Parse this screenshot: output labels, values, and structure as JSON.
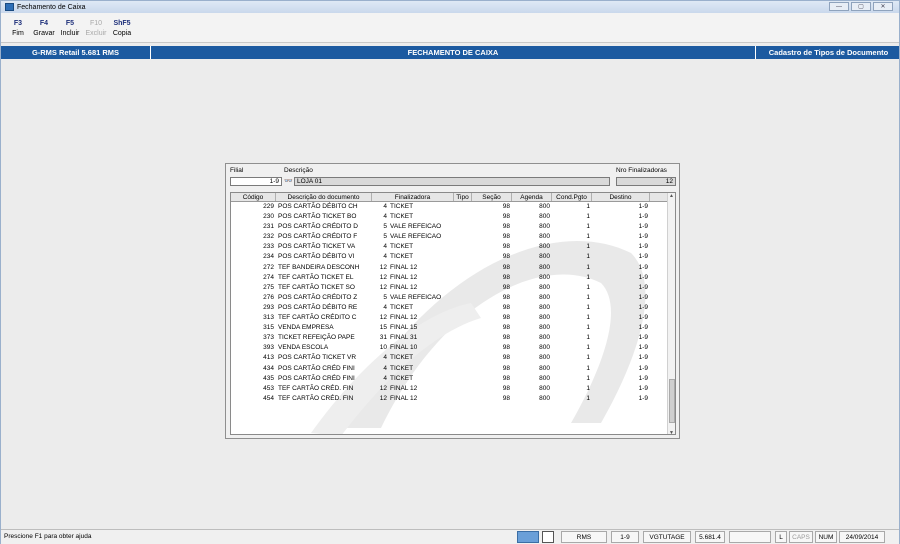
{
  "window": {
    "title": "Fechamento de Caixa",
    "controls": [
      "—",
      "▢",
      "✕"
    ]
  },
  "toolbar": {
    "buttons": [
      {
        "key": "F3",
        "label": "Fim",
        "enabled": true
      },
      {
        "key": "F4",
        "label": "Gravar",
        "enabled": true
      },
      {
        "key": "F5",
        "label": "Incluir",
        "enabled": true
      },
      {
        "key": "F10",
        "label": "Excluir",
        "enabled": false
      },
      {
        "key": "ShF5",
        "label": "Copia",
        "enabled": true
      }
    ]
  },
  "header": {
    "left": "G-RMS Retail 5.681 RMS",
    "center": "FECHAMENTO DE CAIXA",
    "right": "Cadastro de Tipos de Documento"
  },
  "form": {
    "filial_label": "Filial",
    "filial_value": "1-9",
    "descricao_label": "Descrição",
    "descricao_value": "LOJA 01",
    "nro_label": "Nro Finalizadoras",
    "nro_value": "12"
  },
  "table": {
    "columns": [
      "Código",
      "Descrição do documento",
      "Finalizadora",
      "Tipo",
      "Seção",
      "Agenda",
      "Cond.Pgto",
      "Destino"
    ],
    "rows": [
      {
        "codigo": "229",
        "descricao": "POS CARTÃO DÉBITO CH",
        "fin_num": "4",
        "fin_nome": "TICKET",
        "tipo": "",
        "secao": "98",
        "agenda": "800",
        "cond": "1",
        "destino": "1-9"
      },
      {
        "codigo": "230",
        "descricao": "POS CARTÃO TICKET BO",
        "fin_num": "4",
        "fin_nome": "TICKET",
        "tipo": "",
        "secao": "98",
        "agenda": "800",
        "cond": "1",
        "destino": "1-9"
      },
      {
        "codigo": "231",
        "descricao": "POS CARTÃO CRÉDITO D",
        "fin_num": "5",
        "fin_nome": "VALE REFEICAO",
        "tipo": "",
        "secao": "98",
        "agenda": "800",
        "cond": "1",
        "destino": "1-9"
      },
      {
        "codigo": "232",
        "descricao": "POS CARTÃO CRÉDITO F",
        "fin_num": "5",
        "fin_nome": "VALE REFEICAO",
        "tipo": "",
        "secao": "98",
        "agenda": "800",
        "cond": "1",
        "destino": "1-9"
      },
      {
        "codigo": "233",
        "descricao": "POS CARTÃO TICKET VA",
        "fin_num": "4",
        "fin_nome": "TICKET",
        "tipo": "",
        "secao": "98",
        "agenda": "800",
        "cond": "1",
        "destino": "1-9"
      },
      {
        "codigo": "234",
        "descricao": "POS CARTÃO DÉBITO VI",
        "fin_num": "4",
        "fin_nome": "TICKET",
        "tipo": "",
        "secao": "98",
        "agenda": "800",
        "cond": "1",
        "destino": "1-9"
      },
      {
        "codigo": "272",
        "descricao": "TEF BANDEIRA DESCONH",
        "fin_num": "12",
        "fin_nome": "FINAL 12",
        "tipo": "",
        "secao": "98",
        "agenda": "800",
        "cond": "1",
        "destino": "1-9"
      },
      {
        "codigo": "274",
        "descricao": "TEF CARTÃO TICKET EL",
        "fin_num": "12",
        "fin_nome": "FINAL 12",
        "tipo": "",
        "secao": "98",
        "agenda": "800",
        "cond": "1",
        "destino": "1-9"
      },
      {
        "codigo": "275",
        "descricao": "TEF CARTÃO TICKET SO",
        "fin_num": "12",
        "fin_nome": "FINAL 12",
        "tipo": "",
        "secao": "98",
        "agenda": "800",
        "cond": "1",
        "destino": "1-9"
      },
      {
        "codigo": "276",
        "descricao": "POS CARTÃO CRÉDITO Z",
        "fin_num": "5",
        "fin_nome": "VALE REFEICAO",
        "tipo": "",
        "secao": "98",
        "agenda": "800",
        "cond": "1",
        "destino": "1-9"
      },
      {
        "codigo": "293",
        "descricao": "POS CARTÃO DÉBITO RE",
        "fin_num": "4",
        "fin_nome": "TICKET",
        "tipo": "",
        "secao": "98",
        "agenda": "800",
        "cond": "1",
        "destino": "1-9"
      },
      {
        "codigo": "313",
        "descricao": "TEF CARTÃO CRÉDITO C",
        "fin_num": "12",
        "fin_nome": "FINAL 12",
        "tipo": "",
        "secao": "98",
        "agenda": "800",
        "cond": "1",
        "destino": "1-9"
      },
      {
        "codigo": "315",
        "descricao": "VENDA EMPRESA",
        "fin_num": "15",
        "fin_nome": "FINAL 15",
        "tipo": "",
        "secao": "98",
        "agenda": "800",
        "cond": "1",
        "destino": "1-9"
      },
      {
        "codigo": "373",
        "descricao": "TICKET REFEIÇÃO PAPE",
        "fin_num": "31",
        "fin_nome": "FINAL 31",
        "tipo": "",
        "secao": "98",
        "agenda": "800",
        "cond": "1",
        "destino": "1-9"
      },
      {
        "codigo": "393",
        "descricao": "VENDA ESCOLA",
        "fin_num": "10",
        "fin_nome": "FINAL 10",
        "tipo": "",
        "secao": "98",
        "agenda": "800",
        "cond": "1",
        "destino": "1-9"
      },
      {
        "codigo": "413",
        "descricao": "POS CARTÃO TICKET VR",
        "fin_num": "4",
        "fin_nome": "TICKET",
        "tipo": "",
        "secao": "98",
        "agenda": "800",
        "cond": "1",
        "destino": "1-9"
      },
      {
        "codigo": "434",
        "descricao": "POS CARTÃO CRÉD FINI",
        "fin_num": "4",
        "fin_nome": "TICKET",
        "tipo": "",
        "secao": "98",
        "agenda": "800",
        "cond": "1",
        "destino": "1-9"
      },
      {
        "codigo": "435",
        "descricao": "POS CARTÃO CRÉD FINI",
        "fin_num": "4",
        "fin_nome": "TICKET",
        "tipo": "",
        "secao": "98",
        "agenda": "800",
        "cond": "1",
        "destino": "1-9"
      },
      {
        "codigo": "453",
        "descricao": "TEF CARTÃO CRÉD. FIN",
        "fin_num": "12",
        "fin_nome": "FINAL 12",
        "tipo": "",
        "secao": "98",
        "agenda": "800",
        "cond": "1",
        "destino": "1-9"
      },
      {
        "codigo": "454",
        "descricao": "TEF CARTÃO CRÉD. FIN",
        "fin_num": "12",
        "fin_nome": "FINAL 12",
        "tipo": "",
        "secao": "98",
        "agenda": "800",
        "cond": "1",
        "destino": "1-9"
      }
    ]
  },
  "statusbar": {
    "help": "Prescione F1 para obter ajuda",
    "rms": "RMS",
    "filial": "1-9",
    "user": "VGTUTAGE",
    "version": "5.681.4",
    "l": "L",
    "caps": "CAPS",
    "num": "NUM",
    "date": "24/09/2014"
  },
  "colors": {
    "header_bg": "#1c5aa0",
    "selection": "#1e8be6"
  }
}
